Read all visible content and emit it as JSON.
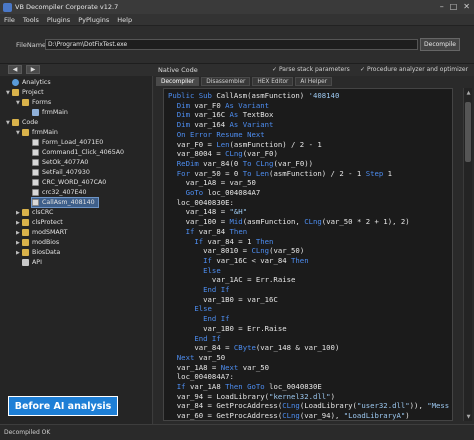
{
  "window": {
    "title": "VB Decompiler Corporate v12.7",
    "icon": "app-icon",
    "controls": [
      "minimize-icon",
      "maximize-icon",
      "close-icon"
    ]
  },
  "menu": {
    "items": [
      "File",
      "Tools",
      "Plugins",
      "PyPlugins",
      "Help"
    ]
  },
  "filebar": {
    "label": "FileName:",
    "value": "D:\\Program\\DotFixTest.exe",
    "decompile_label": "Decompile"
  },
  "navbar": {
    "back": "◀",
    "forward": "▶",
    "native_code": "Native Code",
    "options": [
      "Parse stack parameters",
      "Procedure analyzer and optimizer"
    ]
  },
  "tree": {
    "analytics": "Analytics",
    "project": "Project",
    "forms": "Forms",
    "frmMain_form": "frmMain",
    "code": "Code",
    "frmMain_code": "frmMain",
    "procs": [
      "Form_Load_4071E0",
      "Command1_Click_4065A0",
      "SetOk_4077A0",
      "SetFail_407930",
      "CRC_WORD_407CA0",
      "crc32_407E40",
      "CallAsm_408140"
    ],
    "modules": [
      "clsCRC",
      "clsProtect",
      "modSMART",
      "modBios",
      "BiosData",
      "API"
    ]
  },
  "badge": {
    "text": "Before AI analysis"
  },
  "tabs": [
    "Decompiler",
    "Disassembler",
    "HEX Editor",
    "AI Helper"
  ],
  "code": {
    "lines": [
      [
        [
          "kw",
          "Public Sub "
        ],
        [
          "fn",
          "CallAsm(asmFunction) "
        ],
        [
          "str",
          "'408140"
        ]
      ],
      [
        [
          "kw",
          "  Dim "
        ],
        [
          "fn",
          "var_F0 "
        ],
        [
          "kw",
          "As Variant"
        ]
      ],
      [
        [
          "kw",
          "  Dim "
        ],
        [
          "fn",
          "var_16C "
        ],
        [
          "kw",
          "As "
        ],
        [
          "fn",
          "TextBox"
        ]
      ],
      [
        [
          "kw",
          "  Dim "
        ],
        [
          "fn",
          "var_164 "
        ],
        [
          "kw",
          "As Variant"
        ]
      ],
      [
        [
          "kw",
          "  On Error Resume Next"
        ]
      ],
      [
        [
          "fn",
          "  var_F0 = "
        ],
        [
          "kw",
          "Len"
        ],
        [
          "fn",
          "(asmFunction) / 2 - 1"
        ]
      ],
      [
        [
          "fn",
          "  var_8004 = "
        ],
        [
          "kw",
          "CLng"
        ],
        [
          "fn",
          "(var_F0)"
        ]
      ],
      [
        [
          "kw",
          "  ReDim "
        ],
        [
          "fn",
          "var_84(0 "
        ],
        [
          "kw",
          "To CLng"
        ],
        [
          "fn",
          "(var_F0))"
        ]
      ],
      [
        [
          "kw",
          "  For "
        ],
        [
          "fn",
          "var_50 = 0 "
        ],
        [
          "kw",
          "To Len"
        ],
        [
          "fn",
          "(asmFunction) / 2 - 1 "
        ],
        [
          "kw",
          "Step "
        ],
        [
          "fn",
          "1"
        ]
      ],
      [
        [
          "fn",
          "    var_1A8 = var_50"
        ]
      ],
      [
        [
          "kw",
          "    GoTo "
        ],
        [
          "fn",
          "loc_004084A7"
        ]
      ],
      [
        [
          "fn",
          "  loc_0040830E:"
        ]
      ],
      [
        [
          "fn",
          "    var_148 = "
        ],
        [
          "str",
          "\"&H\""
        ]
      ],
      [
        [
          "fn",
          "    var_100 = "
        ],
        [
          "kw",
          "Mid"
        ],
        [
          "fn",
          "(asmFunction, "
        ],
        [
          "kw",
          "CLng"
        ],
        [
          "fn",
          "(var_50 * 2 + 1), 2)"
        ]
      ],
      [
        [
          "kw",
          "    If "
        ],
        [
          "fn",
          "var_84 "
        ],
        [
          "kw",
          "Then"
        ]
      ],
      [
        [
          "kw",
          "      If "
        ],
        [
          "fn",
          "var_84 = 1 "
        ],
        [
          "kw",
          "Then"
        ]
      ],
      [
        [
          "fn",
          "        var_8010 = "
        ],
        [
          "kw",
          "CLng"
        ],
        [
          "fn",
          "(var_50)"
        ]
      ],
      [
        [
          "kw",
          "        If "
        ],
        [
          "fn",
          "var_16C < var_84 "
        ],
        [
          "kw",
          "Then"
        ]
      ],
      [
        [
          "kw",
          "        Else"
        ]
      ],
      [
        [
          "fn",
          "          var_1AC = Err.Raise"
        ]
      ],
      [
        [
          "kw",
          "        End If"
        ]
      ],
      [
        [
          "fn",
          "        var_1B0 = var_16C"
        ]
      ],
      [
        [
          "kw",
          "      Else"
        ]
      ],
      [
        [
          "kw",
          "        End If"
        ]
      ],
      [
        [
          "fn",
          "        var_1B0 = Err.Raise"
        ]
      ],
      [
        [
          "kw",
          "      End If"
        ]
      ],
      [
        [
          "fn",
          "      var_84 = "
        ],
        [
          "kw",
          "CByte"
        ],
        [
          "fn",
          "(var_148 & var_100)"
        ]
      ],
      [
        [
          "kw",
          "  Next "
        ],
        [
          "fn",
          "var_50"
        ]
      ],
      [
        [
          "fn",
          "  var_1A8 = "
        ],
        [
          "kw",
          "Next "
        ],
        [
          "fn",
          "var_50"
        ]
      ],
      [
        [
          "fn",
          "  loc_004084A7:"
        ]
      ],
      [
        [
          "kw",
          "  If "
        ],
        [
          "fn",
          "var_1A8 "
        ],
        [
          "kw",
          "Then GoTo "
        ],
        [
          "fn",
          "loc_0040830E"
        ]
      ],
      [
        [
          "fn",
          "  var_94 = LoadLibrary("
        ],
        [
          "str",
          "\"kernel32.dll\""
        ],
        [
          "fn",
          ")"
        ]
      ],
      [
        [
          "fn",
          "  var_84 = GetProcAddress("
        ],
        [
          "kw",
          "CLng"
        ],
        [
          "fn",
          "(LoadLibrary("
        ],
        [
          "str",
          "\"user32.dll\""
        ],
        [
          "fn",
          ")), "
        ],
        [
          "str",
          "\"Mess"
        ]
      ],
      [
        [
          "fn",
          "  var_60 = GetProcAddress("
        ],
        [
          "kw",
          "CLng"
        ],
        [
          "fn",
          "(var_94), "
        ],
        [
          "str",
          "\"LoadLibraryA\""
        ],
        [
          "fn",
          ")"
        ]
      ]
    ]
  },
  "status": {
    "text": "Decompiled OK"
  }
}
